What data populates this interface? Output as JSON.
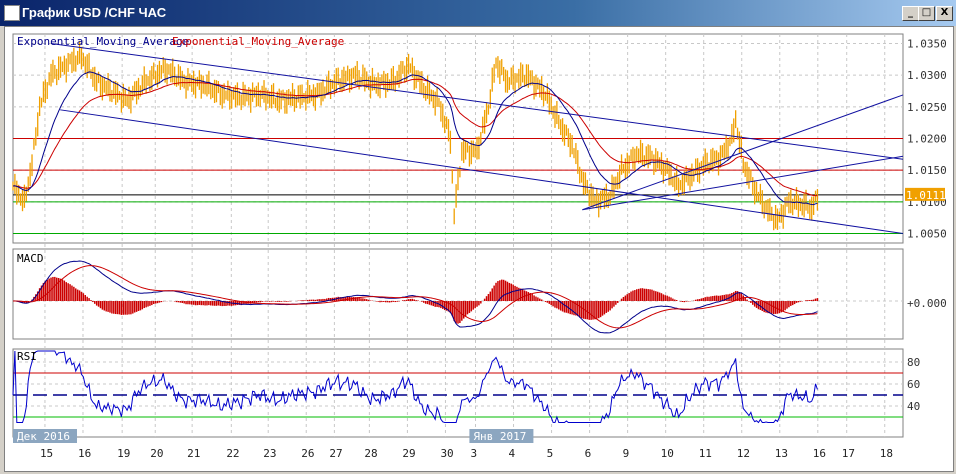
{
  "window": {
    "title": "График USD /CHF  ЧАС",
    "minimize": "_",
    "maximize": "□",
    "close": "X"
  },
  "legend": {
    "ema1": "Exponential_Moving_Average",
    "ema2": "Exponential_Moving_Average"
  },
  "colors": {
    "price": "#f0a000",
    "ema_fast": "#00008b",
    "ema_slow": "#cc0000",
    "trend": "#1010a0",
    "grid": "#c8c8c8"
  },
  "chart_data": {
    "type": "line",
    "price_axis": {
      "min": 1.0035,
      "max": 1.0365,
      "ticks": [
        "1.0350",
        "1.0300",
        "1.0250",
        "1.0200",
        "1.0150",
        "1.0100",
        "1.0050"
      ],
      "last_price": "1.0111"
    },
    "x_axis": {
      "range_days": [
        0,
        23.4
      ],
      "labels": [
        {
          "t": "15",
          "x": 0.84
        },
        {
          "t": "16",
          "x": 1.84
        },
        {
          "t": "19",
          "x": 2.87
        },
        {
          "t": "20",
          "x": 3.74
        },
        {
          "t": "21",
          "x": 4.71
        },
        {
          "t": "22",
          "x": 5.74
        },
        {
          "t": "23",
          "x": 6.71
        },
        {
          "t": "26",
          "x": 7.71
        },
        {
          "t": "27",
          "x": 8.45
        },
        {
          "t": "28",
          "x": 9.37
        },
        {
          "t": "29",
          "x": 10.37
        },
        {
          "t": "30",
          "x": 11.37
        },
        {
          "t": "3",
          "x": 12.16
        },
        {
          "t": "4",
          "x": 13.16
        },
        {
          "t": "5",
          "x": 14.16
        },
        {
          "t": "6",
          "x": 15.16
        },
        {
          "t": "9",
          "x": 16.16
        },
        {
          "t": "10",
          "x": 17.16
        },
        {
          "t": "11",
          "x": 18.16
        },
        {
          "t": "12",
          "x": 19.16
        },
        {
          "t": "13",
          "x": 20.16
        },
        {
          "t": "16",
          "x": 21.16
        },
        {
          "t": "17",
          "x": 21.92
        },
        {
          "t": "18",
          "x": 22.92
        }
      ],
      "month_labels": [
        {
          "t": "Дек 2016",
          "x": 0
        },
        {
          "t": "Янв 2017",
          "x": 12.0
        }
      ]
    },
    "price": [
      [
        0,
        1.0125
      ],
      [
        0.3,
        1.01
      ],
      [
        0.5,
        1.016
      ],
      [
        0.7,
        1.025
      ],
      [
        1,
        1.03
      ],
      [
        1.5,
        1.032
      ],
      [
        1.8,
        1.033
      ],
      [
        2.2,
        1.029
      ],
      [
        2.6,
        1.0275
      ],
      [
        3,
        1.026
      ],
      [
        3.5,
        1.029
      ],
      [
        4,
        1.031
      ],
      [
        4.5,
        1.029
      ],
      [
        5,
        1.0285
      ],
      [
        5.5,
        1.027
      ],
      [
        6,
        1.0265
      ],
      [
        6.5,
        1.027
      ],
      [
        7,
        1.026
      ],
      [
        7.5,
        1.0265
      ],
      [
        8,
        1.027
      ],
      [
        8.5,
        1.029
      ],
      [
        9,
        1.03
      ],
      [
        9.5,
        1.0285
      ],
      [
        10,
        1.029
      ],
      [
        10.4,
        1.0315
      ],
      [
        10.8,
        1.028
      ],
      [
        11.2,
        1.0255
      ],
      [
        11.5,
        1.02
      ],
      [
        11.6,
        1.008
      ],
      [
        11.8,
        1.018
      ],
      [
        12.2,
        1.018
      ],
      [
        12.5,
        1.025
      ],
      [
        12.7,
        1.032
      ],
      [
        13,
        1.029
      ],
      [
        13.5,
        1.03
      ],
      [
        14,
        1.027
      ],
      [
        14.4,
        1.022
      ],
      [
        14.7,
        1.019
      ],
      [
        15,
        1.013
      ],
      [
        15.3,
        1.01
      ],
      [
        15.7,
        1.011
      ],
      [
        16,
        1.015
      ],
      [
        16.4,
        1.0175
      ],
      [
        16.8,
        1.017
      ],
      [
        17.2,
        1.015
      ],
      [
        17.5,
        1.0125
      ],
      [
        17.8,
        1.014
      ],
      [
        18.2,
        1.016
      ],
      [
        18.6,
        1.017
      ],
      [
        18.9,
        1.02
      ],
      [
        19,
        1.023
      ],
      [
        19.2,
        1.016
      ],
      [
        19.5,
        1.012
      ],
      [
        19.8,
        1.009
      ],
      [
        20.1,
        1.007
      ],
      [
        20.4,
        1.01
      ],
      [
        20.8,
        1.0095
      ],
      [
        21,
        1.009
      ],
      [
        21.2,
        1.0111
      ]
    ],
    "hlines": [
      {
        "v": 1.02,
        "c": "#cc0000"
      },
      {
        "v": 1.015,
        "c": "#cc0000"
      },
      {
        "v": 1.0111,
        "c": "#000000"
      },
      {
        "v": 1.01,
        "c": "#00aa00"
      },
      {
        "v": 1.005,
        "c": "#00aa00"
      }
    ],
    "trendlines": [
      [
        [
          1.0,
          1.035
        ],
        [
          23.4,
          1.01672
        ]
      ],
      [
        [
          1.24,
          1.02453
        ],
        [
          23.4,
          1.005
        ]
      ],
      [
        [
          14.97,
          1.00875
        ],
        [
          23.4,
          1.02688
        ]
      ],
      [
        [
          14.97,
          1.00875
        ],
        [
          23.4,
          1.0172
        ]
      ]
    ],
    "macd": {
      "label": "MACD",
      "tick": "+0.000"
    },
    "rsi": {
      "label": "RSI",
      "ticks": [
        "80",
        "60",
        "40"
      ],
      "levels": [
        70,
        30
      ],
      "mid": 50
    }
  }
}
